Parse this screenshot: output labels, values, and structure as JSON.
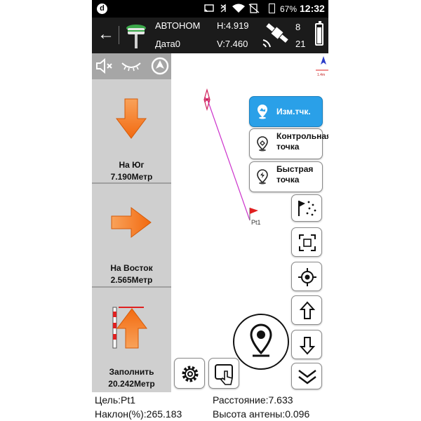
{
  "status_bar": {
    "app_icon": "d",
    "icons": "cast bluetooth wifi no-sim",
    "battery_percent": "67%",
    "time": "12:32"
  },
  "top_bar": {
    "mode": "АВТОНОМ",
    "data_label": "Дата0",
    "h_value": "H:4.919",
    "v_value": "V:7.460",
    "sat_used": "8",
    "sat_total": "21"
  },
  "left_panel": {
    "icons": [
      "mute-icon",
      "eye-closed-icon",
      "navigation-arrow-icon"
    ],
    "south": {
      "label": "На Юг",
      "value": "7.190Метр"
    },
    "east": {
      "label": "На Восток",
      "value": "2.565Метр"
    },
    "fill": {
      "label": "Заполнить",
      "value": "20.242Метр"
    }
  },
  "map": {
    "scale_label": "1.4m",
    "point_label": "Pt1",
    "buttons": {
      "measure_point": "Изм.тчк.",
      "control_point": "Контрольная точка",
      "quick_point": "Быстрая точка"
    }
  },
  "bottom": {
    "target": "Цель:Pt1",
    "distance": "Расстояние:7.633",
    "tilt": "Наклон(%):265.183",
    "antenna_height": "Высота антены:0.096"
  },
  "colors": {
    "accent_blue": "#2aa0e8",
    "arrow_orange": "#f57f25",
    "track_magenta": "#cc33cc",
    "flag_red": "#e02020"
  }
}
